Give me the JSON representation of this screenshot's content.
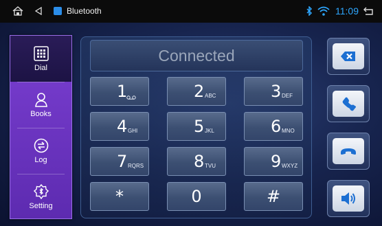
{
  "statusbar": {
    "title": "Bluetooth",
    "time": "11:09",
    "icons": [
      "home-icon",
      "back-icon",
      "bluetooth-app-icon",
      "bluetooth-status-icon",
      "wifi-icon",
      "return-icon"
    ],
    "time_color": "#2ea7ff"
  },
  "sidebar": {
    "items": [
      {
        "label": "Dial",
        "icon": "dialpad-icon",
        "active": true
      },
      {
        "label": "Books",
        "icon": "contact-icon",
        "active": false
      },
      {
        "label": "Log",
        "icon": "call-log-icon",
        "active": false
      },
      {
        "label": "Setting",
        "icon": "settings-icon",
        "active": false
      }
    ],
    "accent": "#7b3fd2"
  },
  "display": {
    "text": "Connected"
  },
  "keypad": {
    "keys": [
      {
        "num": "1",
        "sub": "voicemail"
      },
      {
        "num": "2",
        "sub": "ABC"
      },
      {
        "num": "3",
        "sub": "DEF"
      },
      {
        "num": "4",
        "sub": "GHI"
      },
      {
        "num": "5",
        "sub": "JKL"
      },
      {
        "num": "6",
        "sub": "MNO"
      },
      {
        "num": "7",
        "sub": "RQRS"
      },
      {
        "num": "8",
        "sub": "TVU"
      },
      {
        "num": "9",
        "sub": "WXYZ"
      },
      {
        "num": "*",
        "sub": ""
      },
      {
        "num": "0",
        "sub": ""
      },
      {
        "num": "#",
        "sub": ""
      }
    ]
  },
  "actions": [
    {
      "name": "backspace-button",
      "icon": "backspace-icon"
    },
    {
      "name": "call-button",
      "icon": "phone-icon"
    },
    {
      "name": "hangup-button",
      "icon": "hangup-icon"
    },
    {
      "name": "volume-button",
      "icon": "volume-icon"
    }
  ],
  "colors": {
    "action_icon": "#1c6fd2"
  }
}
